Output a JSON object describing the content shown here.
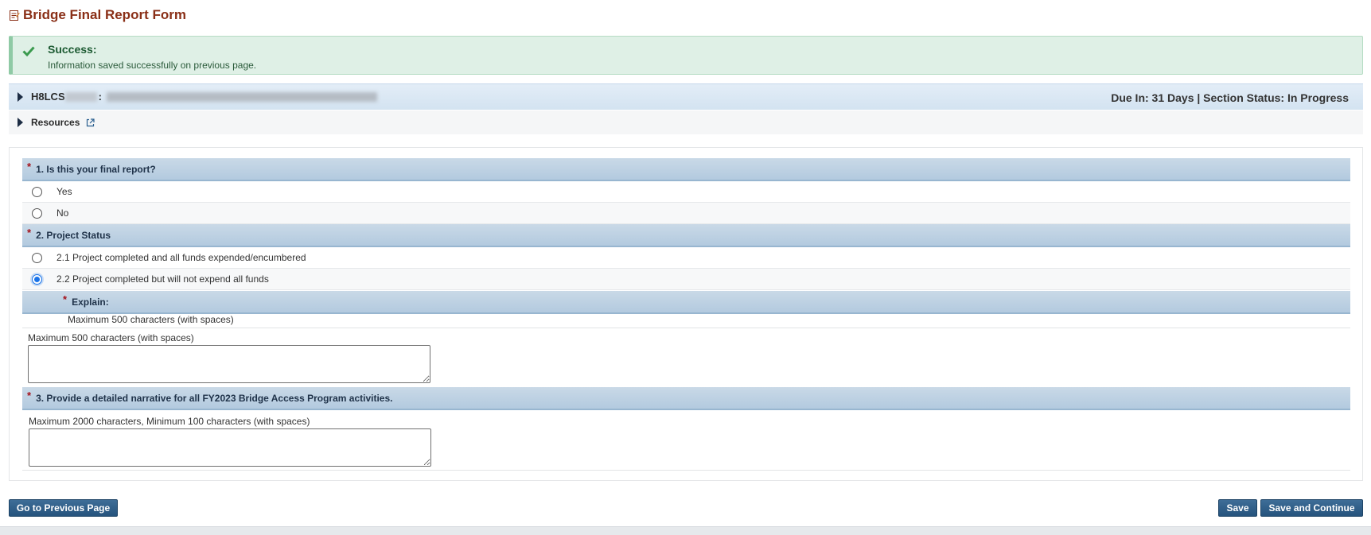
{
  "page": {
    "title": "Bridge Final Report Form"
  },
  "alert": {
    "title": "Success:",
    "message": "Information saved successfully on previous page."
  },
  "grant": {
    "id_prefix": "H8LCS",
    "separator": ":",
    "status": "Due In: 31 Days | Section Status: In Progress"
  },
  "resources": {
    "label": "Resources"
  },
  "questions": {
    "q1": {
      "label": "1. Is this your final report?",
      "options": [
        "Yes",
        "No"
      ],
      "selected": null
    },
    "q2": {
      "label": "2. Project Status",
      "options": [
        "2.1 Project completed and all funds expended/encumbered",
        "2.2 Project completed but will not expend all funds"
      ],
      "selected": 1,
      "explain": {
        "label": "Explain:",
        "note": "Maximum 500 characters (with spaces)",
        "field_note": "Maximum 500 characters (with spaces)",
        "value": ""
      }
    },
    "q3": {
      "label": "3. Provide a detailed narrative for all FY2023 Bridge Access Program activities.",
      "field_note": "Maximum 2000 characters, Minimum 100 characters (with spaces)",
      "value": ""
    }
  },
  "buttons": {
    "previous": "Go to Previous Page",
    "save": "Save",
    "save_continue": "Save and Continue"
  },
  "colors": {
    "title": "#8a2f17",
    "success_bg": "#dff0e6",
    "header_bg": "#b3cadf",
    "button": "#25537d",
    "required": "#a4121b"
  }
}
